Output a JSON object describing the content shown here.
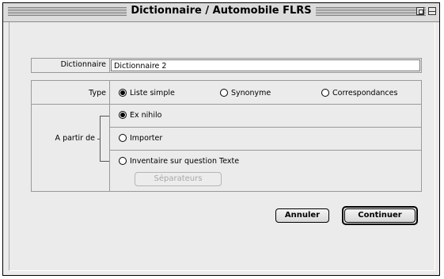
{
  "window": {
    "title": "Dictionnaire / Automobile FLRS"
  },
  "dictionary": {
    "label": "Dictionnaire",
    "value": "Dictionnaire 2"
  },
  "type": {
    "label": "Type",
    "options": [
      {
        "label": "Liste simple",
        "selected": true
      },
      {
        "label": "Synonyme",
        "selected": false
      },
      {
        "label": "Correspondances",
        "selected": false
      }
    ]
  },
  "source": {
    "label": "A partir de",
    "options": [
      {
        "label": "Ex nihilo",
        "selected": true
      },
      {
        "label": "Importer",
        "selected": false
      },
      {
        "label": "Inventaire sur question Texte",
        "selected": false
      }
    ],
    "separators_label": "Séparateurs"
  },
  "actions": {
    "cancel_label": "Annuler",
    "continue_label": "Continuer"
  }
}
